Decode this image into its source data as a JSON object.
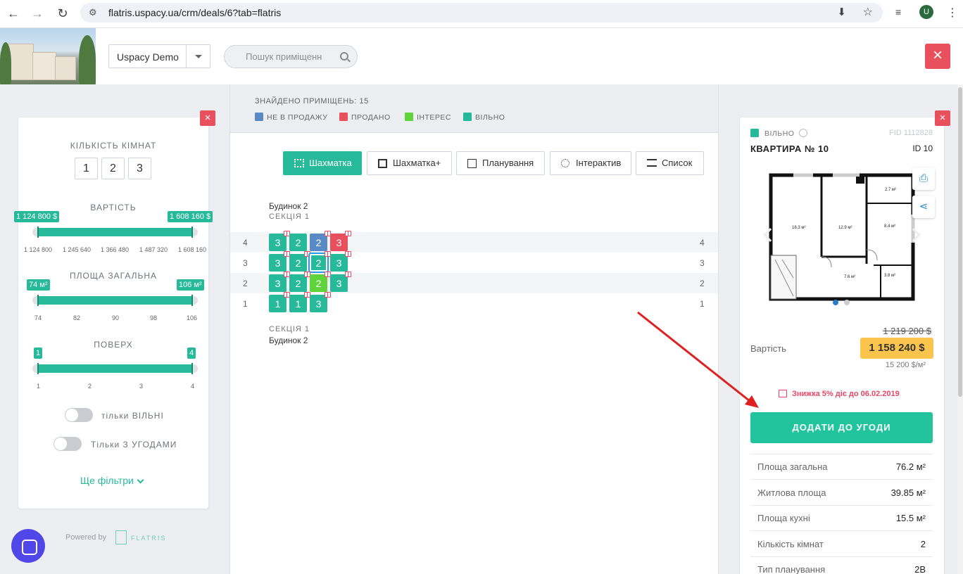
{
  "browser": {
    "url": "flatris.uspacy.ua/crm/deals/6?tab=flatris",
    "avatar": "U"
  },
  "header": {
    "project": "Uspacy Demo",
    "search_placeholder": "Пошук приміщенн",
    "close": "×"
  },
  "filters": {
    "close": "×",
    "rooms_title": "КІЛЬКІСТЬ КІМНАТ",
    "rooms": [
      "1",
      "2",
      "3"
    ],
    "price": {
      "title": "ВАРТІСТЬ",
      "min": "1 124 800 $",
      "max": "1 608 160 $",
      "ticks": [
        "1 124 800",
        "1 245 640",
        "1 366 480",
        "1 487 320",
        "1 608 160"
      ]
    },
    "area": {
      "title": "ПЛОЩА ЗАГАЛЬНА",
      "min": "74 м²",
      "max": "106 м²",
      "ticks": [
        "74",
        "82",
        "90",
        "98",
        "106"
      ]
    },
    "floors": {
      "title": "ПОВЕРХ",
      "min": "1",
      "max": "4",
      "ticks": [
        "1",
        "2",
        "3",
        "4"
      ]
    },
    "only_free": "тільки ВІЛЬНІ",
    "only_deals": "Тільки З УГОДАМИ",
    "more": "Ще фільтри"
  },
  "powered_by": "Powered by",
  "brand": "FLATRIS",
  "center": {
    "found": "ЗНАЙДЕНО ПРИМІЩЕНЬ: 15",
    "legend": [
      {
        "label": "НЕ В ПРОДАЖУ",
        "color": "#5a8ac6"
      },
      {
        "label": "ПРОДАНО",
        "color": "#e9505e"
      },
      {
        "label": "ІНТЕРЕС",
        "color": "#5fd33a"
      },
      {
        "label": "ВІЛЬНО",
        "color": "#26b99a"
      }
    ],
    "tabs": [
      "Шахматка",
      "Шахматка+",
      "Планування",
      "Інтерактив",
      "Список"
    ],
    "building": "Будинок 2",
    "section": "СЕКЦІЯ 1",
    "floors": [
      {
        "floor": "4",
        "cells": [
          {
            "r": "3",
            "s": "free",
            "g": true
          },
          {
            "r": "2",
            "s": "free",
            "g": false
          },
          {
            "r": "2",
            "s": "not_for_sale",
            "g": true
          },
          {
            "r": "3",
            "s": "sold",
            "g": true
          }
        ]
      },
      {
        "floor": "3",
        "cells": [
          {
            "r": "3",
            "s": "free",
            "g": true
          },
          {
            "r": "2",
            "s": "free",
            "g": true
          },
          {
            "r": "2",
            "s": "selected",
            "g": true
          },
          {
            "r": "3",
            "s": "free",
            "g": true
          }
        ]
      },
      {
        "floor": "2",
        "cells": [
          {
            "r": "3",
            "s": "free",
            "g": true
          },
          {
            "r": "2",
            "s": "free",
            "g": true
          },
          {
            "r": "2",
            "s": "interest",
            "g": true
          },
          {
            "r": "3",
            "s": "free",
            "g": true
          }
        ]
      },
      {
        "floor": "1",
        "cells": [
          {
            "r": "1",
            "s": "free",
            "g": true
          },
          {
            "r": "1",
            "s": "free",
            "g": true
          },
          {
            "r": "3",
            "s": "free",
            "g": true
          }
        ]
      }
    ]
  },
  "card": {
    "close": "×",
    "status": "ВІЛЬНО",
    "fid": "FID 1112828",
    "title": "КВАРТИРА № 10",
    "id": "ID 10",
    "plan_labels": [
      "18.3 м²",
      "12.9 м²",
      "2.7 м²",
      "8.4 м²",
      "7.6 м²",
      "3.8 м²"
    ],
    "old_price": "1 219 200 $",
    "price_label": "Вартість",
    "price": "1 158 240 $",
    "price_per_m": "15 200 $/м²",
    "discount": "Знижка 5% діє до 06.02.2019",
    "add_button": "ДОДАТИ ДО УГОДИ",
    "props": [
      {
        "k": "Площа загальна",
        "v": "76.2 м²"
      },
      {
        "k": "Житлова площа",
        "v": "39.85 м²"
      },
      {
        "k": "Площа кухні",
        "v": "15.5 м²"
      },
      {
        "k": "Кількість кімнат",
        "v": "2"
      },
      {
        "k": "Тип планування",
        "v": "2В"
      }
    ]
  }
}
